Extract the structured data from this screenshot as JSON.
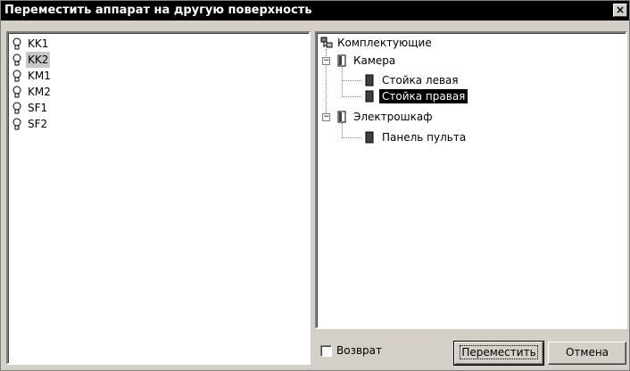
{
  "dialog": {
    "title": "Переместить аппарат на другую поверхность",
    "close_glyph": "×"
  },
  "left_list": {
    "items": [
      "KK1",
      "KK2",
      "KM1",
      "KM2",
      "SF1",
      "SF2"
    ],
    "selected": "KK2"
  },
  "tree": {
    "root": "Комплектующие",
    "groups": [
      {
        "label": "Камера",
        "children": [
          "Стойка левая",
          "Стойка правая"
        ]
      },
      {
        "label": "Электрошкаф",
        "children": [
          "Панель пульта"
        ]
      }
    ],
    "selected": "Стойка правая",
    "expand_glyph": "−"
  },
  "footer": {
    "checkbox_label": "Возврат",
    "checkbox_checked": false,
    "move_button": "Переместить",
    "cancel_button": "Отмена"
  }
}
